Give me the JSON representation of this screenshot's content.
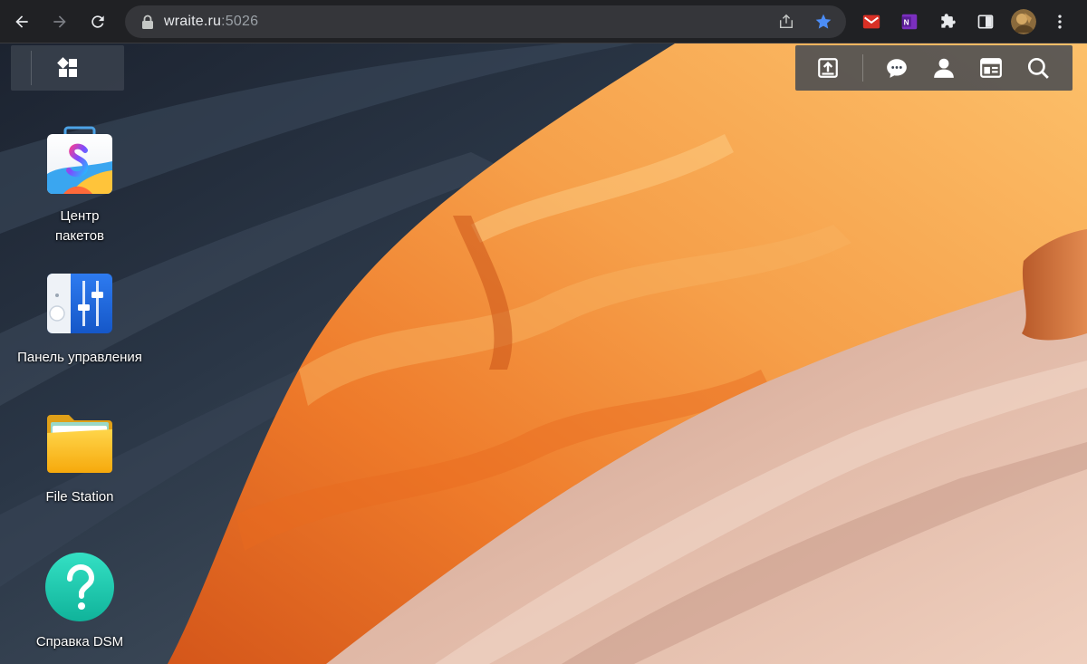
{
  "browser": {
    "url_host": "wraite.ru",
    "url_port": ":5026",
    "back_icon": "arrow-left-icon",
    "forward_icon": "arrow-right-icon",
    "reload_icon": "reload-icon",
    "star_color": "#4c8df6"
  },
  "taskbar": {
    "main_menu_icon": "grid-icon",
    "right_icons": [
      "upload-icon",
      "chat-icon",
      "user-icon",
      "widgets-icon",
      "search-icon"
    ]
  },
  "desktop": {
    "apps": [
      {
        "id": "package-center",
        "label_line1": "Центр",
        "label_line2": "пакетов"
      },
      {
        "id": "control-panel",
        "label_line1": "Панель управления"
      },
      {
        "id": "file-station",
        "label_line1": "File Station"
      },
      {
        "id": "dsm-help",
        "label_line1": "Справка DSM"
      }
    ]
  }
}
